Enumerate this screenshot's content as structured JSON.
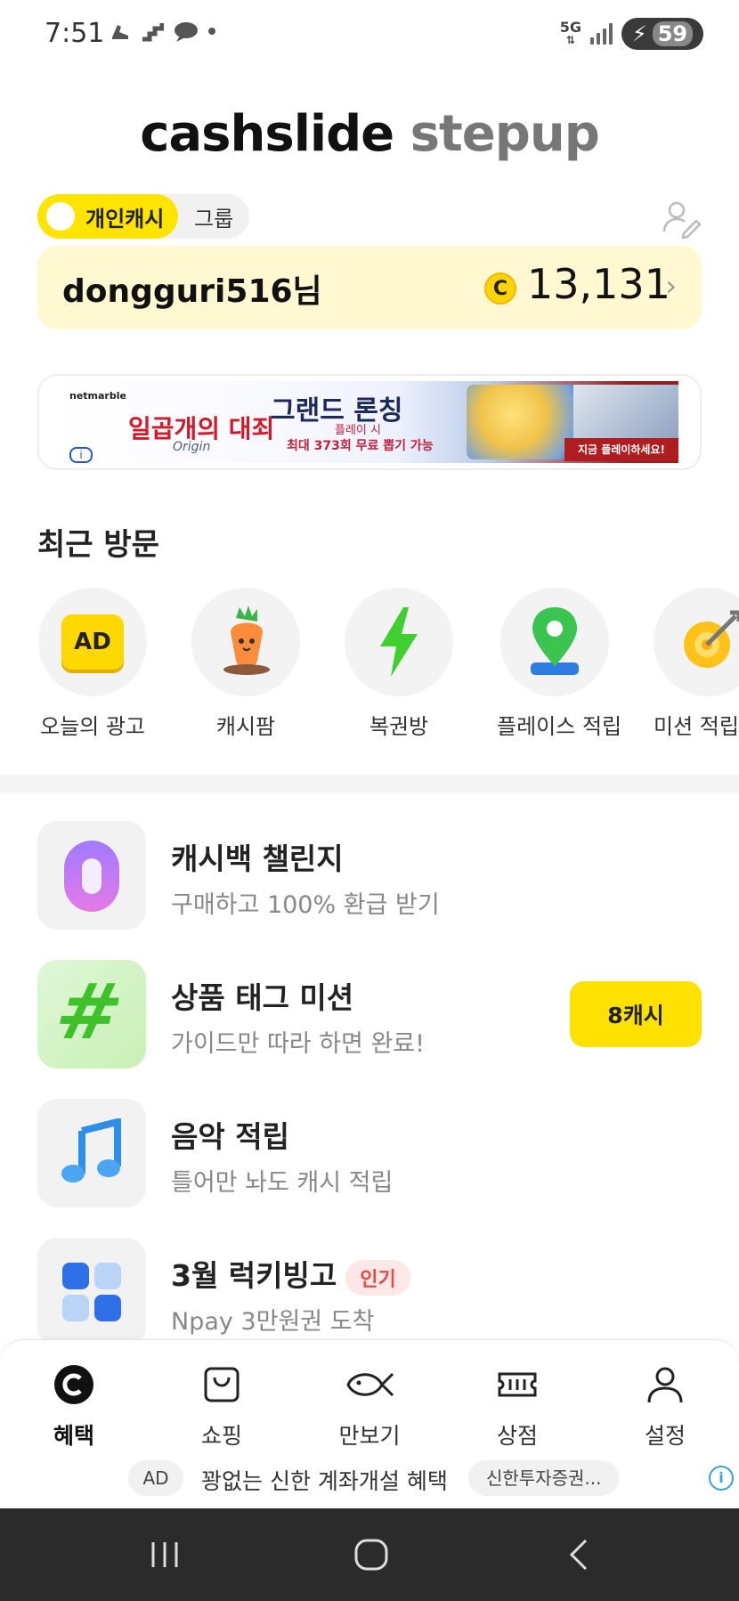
{
  "status_bar": {
    "time": "7:51",
    "left_icons": [
      "shoe-icon",
      "steps-icon",
      "bird-icon",
      "dot-icon"
    ],
    "network": "5G",
    "battery": "59"
  },
  "header": {
    "logo_primary": "cashslide",
    "logo_secondary": "stepup"
  },
  "mode_toggle": {
    "active_label": "개인캐시",
    "inactive_label": "그룹"
  },
  "user_card": {
    "username": "dongguri516님",
    "coin_symbol": "C",
    "cash": "13,131"
  },
  "banner": {
    "brand": "netmarble",
    "game_title": "일곱개의 대죄",
    "game_subtitle": "Origin",
    "headline": "그랜드 론칭",
    "sub1": "플레이 시",
    "sub2": "최대 373회 무료 뽑기 가능",
    "cta": "지금 플레이하세요!"
  },
  "recent": {
    "title": "최근 방문",
    "items": [
      {
        "label": "오늘의 광고",
        "icon": "ad-badge-icon",
        "badge": "AD"
      },
      {
        "label": "캐시팜",
        "icon": "carrot-icon"
      },
      {
        "label": "복권방",
        "icon": "lightning-icon"
      },
      {
        "label": "플레이스 적립",
        "icon": "map-pin-icon"
      },
      {
        "label": "미션 적립",
        "icon": "target-icon"
      }
    ]
  },
  "list": [
    {
      "title": "캐시백 챌린지",
      "desc": "구매하고 100% 환급 받기",
      "icon": "zero-icon"
    },
    {
      "title": "상품 태그 미션",
      "desc": "가이드만 따라 하면 완료!",
      "icon": "hashtag-icon",
      "reward": "8캐시"
    },
    {
      "title": "음악 적립",
      "desc": "틀어만 놔도 캐시 적립",
      "icon": "music-note-icon"
    },
    {
      "title": "3월 럭키빙고",
      "desc": "Npay 3만원권 도착",
      "icon": "bingo-grid-icon",
      "badge": "인기"
    }
  ],
  "bottom_nav": [
    {
      "label": "혜택",
      "icon": "cash-c-icon",
      "active": true
    },
    {
      "label": "쇼핑",
      "icon": "shopping-bag-icon"
    },
    {
      "label": "만보기",
      "icon": "fish-icon"
    },
    {
      "label": "상점",
      "icon": "ticket-icon"
    },
    {
      "label": "설정",
      "icon": "person-icon"
    }
  ],
  "ad_strip": {
    "tag": "AD",
    "text": "꽝없는 신한 계좌개설 혜택",
    "sponsor": "신한투자증권..."
  },
  "colors": {
    "accent": "#ffe100",
    "card_bg": "#fff8d1",
    "hot_badge": "#e24b4b"
  }
}
